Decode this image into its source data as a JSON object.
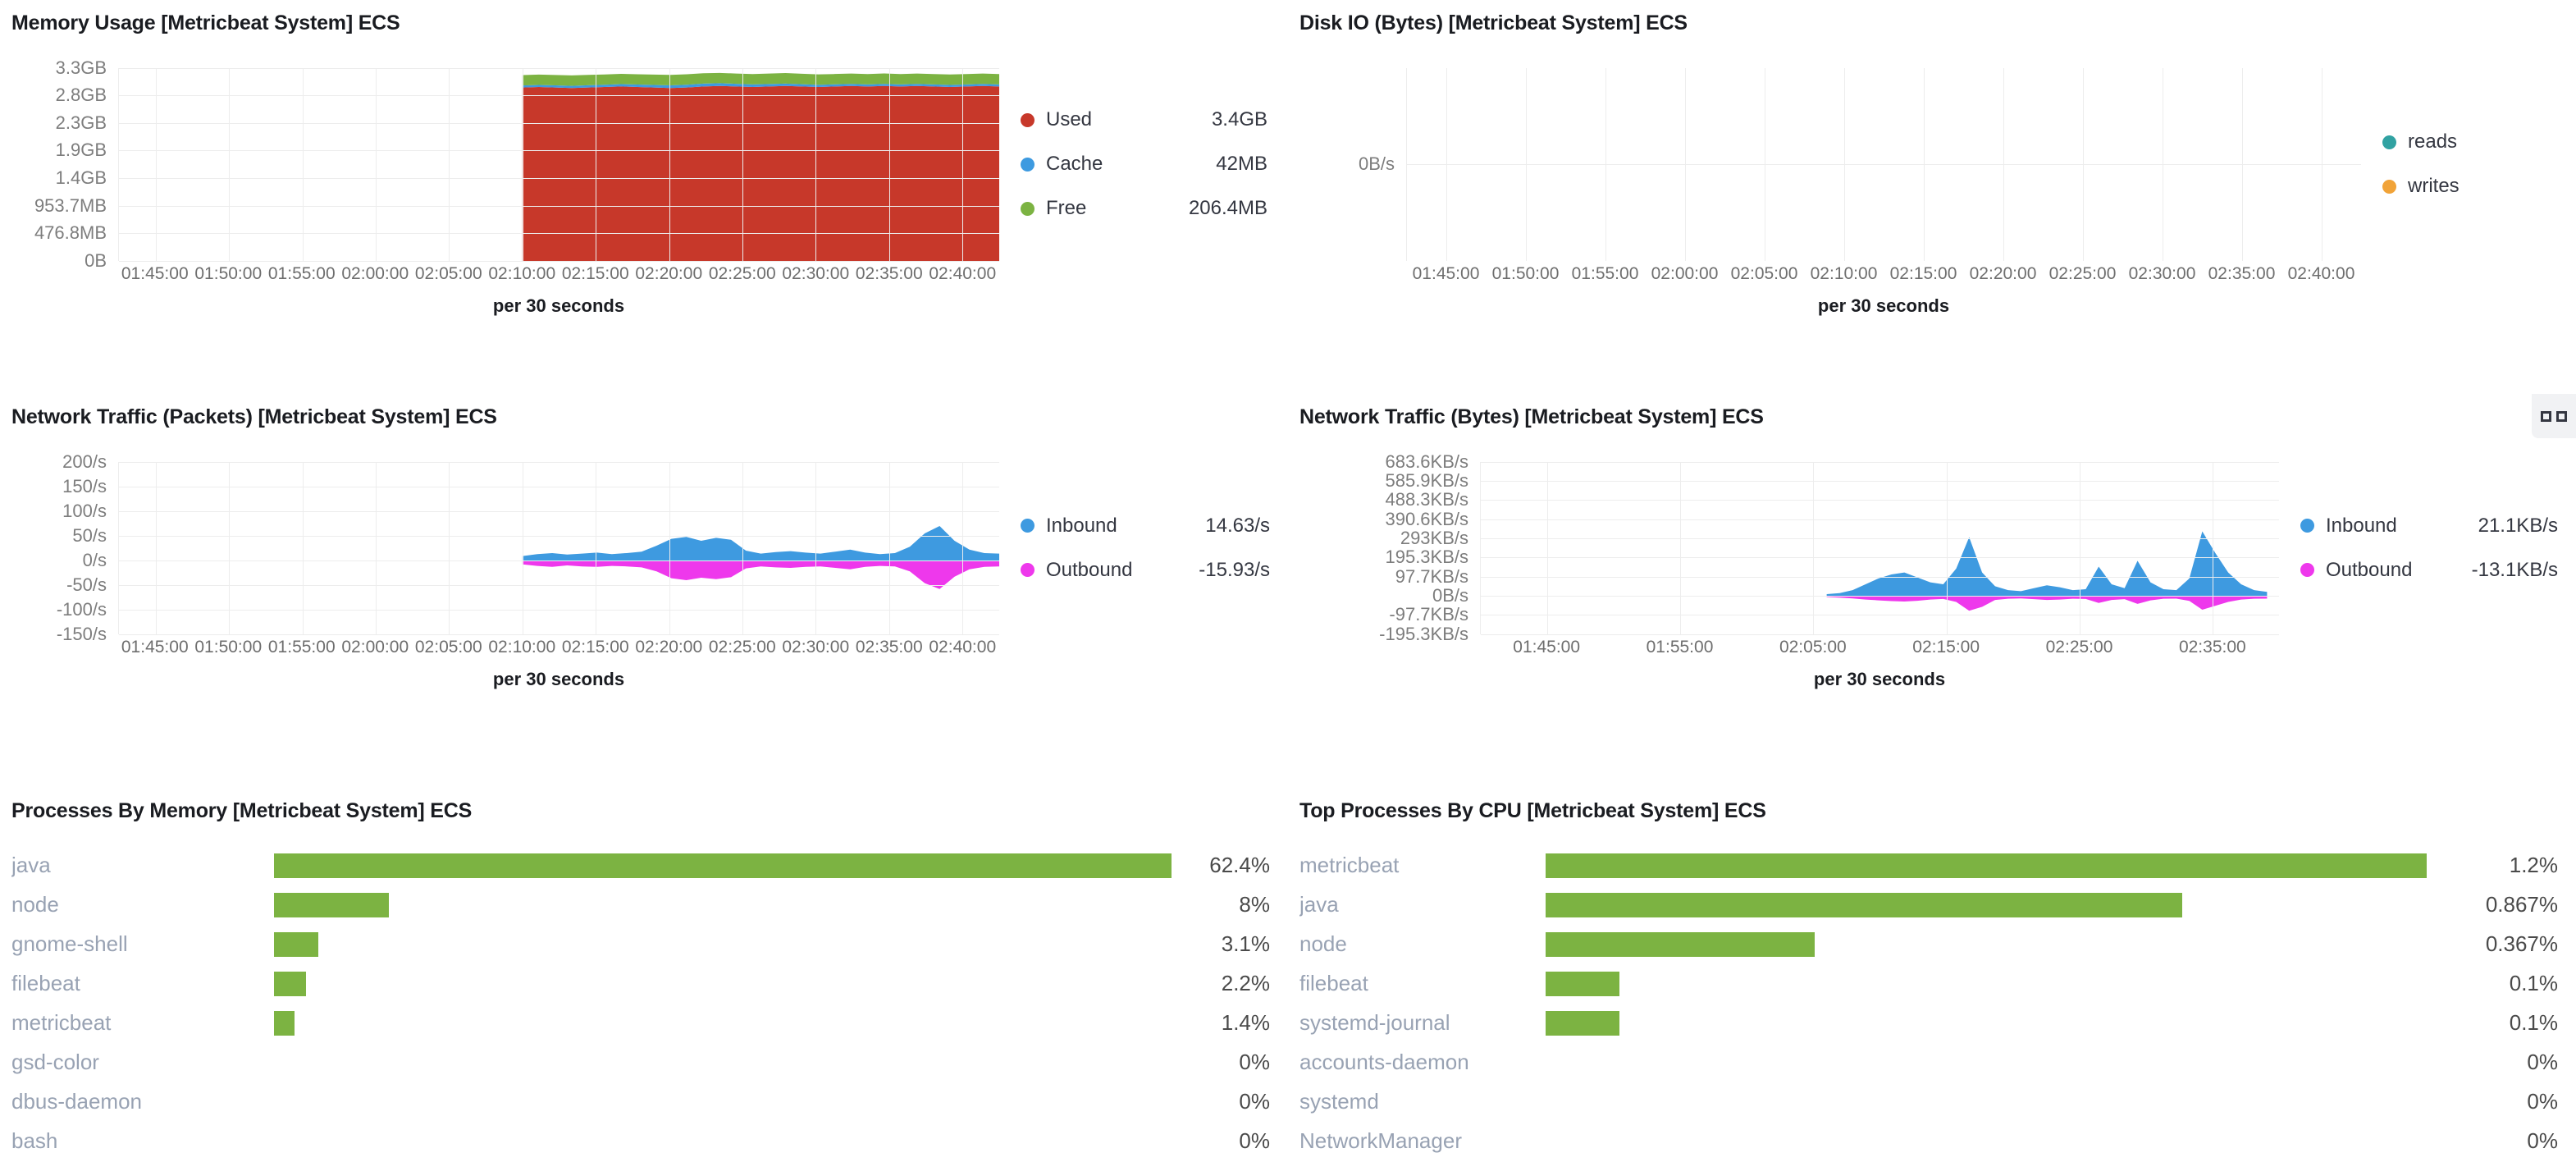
{
  "colors": {
    "used": "#c7382a",
    "cache": "#3d9ae0",
    "free": "#7cb342",
    "inbound": "#3e9ae0",
    "outbound": "#ee38ec",
    "reads": "#31a2a2",
    "writes": "#f1a338",
    "bar": "#7cb342",
    "grid": "#ededed",
    "axis_text": "#7d7d7d",
    "label_text": "#98a2b3"
  },
  "panels": {
    "memory": {
      "title": "Memory Usage [Metricbeat System] ECS",
      "x_label": "per 30 seconds",
      "legend": [
        {
          "label": "Used",
          "value": "3.4GB",
          "color_key": "used"
        },
        {
          "label": "Cache",
          "value": "42MB",
          "color_key": "cache"
        },
        {
          "label": "Free",
          "value": "206.4MB",
          "color_key": "free"
        }
      ]
    },
    "disk_io": {
      "title": "Disk IO (Bytes) [Metricbeat System] ECS",
      "x_label": "per 30 seconds",
      "legend": [
        {
          "label": "reads",
          "value": "",
          "color_key": "reads"
        },
        {
          "label": "writes",
          "value": "",
          "color_key": "writes"
        }
      ]
    },
    "net_packets": {
      "title": "Network Traffic (Packets) [Metricbeat System] ECS",
      "x_label": "per 30 seconds",
      "legend": [
        {
          "label": "Inbound",
          "value": "14.63/s",
          "color_key": "inbound"
        },
        {
          "label": "Outbound",
          "value": "-15.93/s",
          "color_key": "outbound"
        }
      ]
    },
    "net_bytes": {
      "title": "Network Traffic (Bytes) [Metricbeat System] ECS",
      "x_label": "per 30 seconds",
      "menu_icon": "panel-options-icon",
      "legend": [
        {
          "label": "Inbound",
          "value": "21.1KB/s",
          "color_key": "inbound"
        },
        {
          "label": "Outbound",
          "value": "-13.1KB/s",
          "color_key": "outbound"
        }
      ]
    },
    "proc_memory": {
      "title": "Processes By Memory [Metricbeat System] ECS"
    },
    "proc_cpu": {
      "title": "Top Processes By CPU [Metricbeat System] ECS"
    }
  },
  "chart_data": [
    {
      "id": "memory_usage",
      "type": "area",
      "title": "Memory Usage [Metricbeat System] ECS",
      "xlabel": "per 30 seconds",
      "ylabel": "",
      "grid": true,
      "legend_position": "right",
      "yticks": [
        "3.3GB",
        "2.8GB",
        "2.3GB",
        "1.9GB",
        "1.4GB",
        "953.7MB",
        "476.8MB",
        "0B"
      ],
      "ytick_values": [
        3543348019,
        3006477107,
        2469606195,
        2040109465,
        1503238553,
        1000000000,
        500000000,
        0
      ],
      "ylim": [
        0,
        3758096384
      ],
      "xticks": [
        "01:45:00",
        "01:50:00",
        "01:55:00",
        "02:00:00",
        "02:05:00",
        "02:10:00",
        "02:15:00",
        "02:20:00",
        "02:25:00",
        "02:30:00",
        "02:35:00",
        "02:40:00"
      ],
      "data_start_tick": "02:10:00",
      "stacked": true,
      "series": [
        {
          "name": "Used",
          "color": "#c7382a",
          "units": "GB",
          "values": [
            3.38,
            3.39,
            3.38,
            3.37,
            3.38,
            3.39,
            3.4,
            3.39,
            3.38,
            3.37,
            3.38,
            3.4,
            3.41,
            3.4,
            3.39,
            3.4,
            3.41,
            3.4,
            3.39,
            3.4,
            3.41,
            3.4,
            3.41,
            3.4,
            3.41,
            3.4,
            3.39,
            3.4,
            3.41,
            3.4
          ]
        },
        {
          "name": "Cache",
          "color": "#3d9ae0",
          "units": "MB",
          "values": [
            42,
            42,
            43,
            44,
            45,
            46,
            48,
            50,
            52,
            54,
            56,
            58,
            56,
            54,
            52,
            50,
            48,
            46,
            44,
            43,
            42,
            42,
            42,
            42,
            42,
            42,
            42,
            42,
            42,
            42
          ]
        },
        {
          "name": "Free",
          "color": "#7cb342",
          "units": "MB",
          "values": [
            206.4,
            205,
            207,
            208,
            206,
            204,
            203,
            205,
            207,
            209,
            208,
            206,
            205,
            204,
            206,
            208,
            210,
            209,
            207,
            206,
            205,
            206,
            207,
            206,
            205,
            206,
            207,
            206,
            205,
            206.4
          ]
        }
      ],
      "current": {
        "Used": "3.4GB",
        "Cache": "42MB",
        "Free": "206.4MB"
      }
    },
    {
      "id": "disk_io_bytes",
      "type": "line",
      "title": "Disk IO (Bytes) [Metricbeat System] ECS",
      "xlabel": "per 30 seconds",
      "grid": true,
      "legend_position": "right",
      "yticks": [
        "0B/s"
      ],
      "ylim": [
        0,
        0
      ],
      "xticks": [
        "01:45:00",
        "01:50:00",
        "01:55:00",
        "02:00:00",
        "02:05:00",
        "02:10:00",
        "02:15:00",
        "02:20:00",
        "02:25:00",
        "02:30:00",
        "02:35:00",
        "02:40:00"
      ],
      "series": [
        {
          "name": "reads",
          "color": "#31a2a2",
          "values": []
        },
        {
          "name": "writes",
          "color": "#f1a338",
          "values": []
        }
      ],
      "note": "no data plotted"
    },
    {
      "id": "network_packets",
      "type": "area",
      "title": "Network Traffic (Packets) [Metricbeat System] ECS",
      "xlabel": "per 30 seconds",
      "grid": true,
      "legend_position": "right",
      "yticks": [
        "200/s",
        "150/s",
        "100/s",
        "50/s",
        "0/s",
        "-50/s",
        "-100/s",
        "-150/s"
      ],
      "ytick_values": [
        200,
        150,
        100,
        50,
        0,
        -50,
        -100,
        -150
      ],
      "ylim": [
        -150,
        200
      ],
      "xticks": [
        "01:45:00",
        "01:50:00",
        "01:55:00",
        "02:00:00",
        "02:05:00",
        "02:10:00",
        "02:15:00",
        "02:20:00",
        "02:25:00",
        "02:30:00",
        "02:35:00",
        "02:40:00"
      ],
      "data_start_tick": "02:10:00",
      "series": [
        {
          "name": "Inbound",
          "color": "#3e9ae0",
          "values": [
            9,
            13,
            15,
            12,
            14,
            16,
            13,
            15,
            18,
            30,
            44,
            48,
            40,
            46,
            42,
            20,
            14,
            17,
            19,
            16,
            14,
            18,
            22,
            16,
            13,
            15,
            28,
            55,
            70,
            40,
            22,
            15,
            14
          ]
        },
        {
          "name": "Outbound",
          "color": "#ee38ec",
          "values": [
            -8,
            -11,
            -13,
            -10,
            -12,
            -13,
            -11,
            -12,
            -14,
            -22,
            -36,
            -40,
            -35,
            -38,
            -34,
            -16,
            -12,
            -14,
            -15,
            -13,
            -12,
            -15,
            -18,
            -13,
            -11,
            -12,
            -22,
            -46,
            -58,
            -33,
            -18,
            -13,
            -12
          ]
        }
      ],
      "current": {
        "Inbound": "14.63/s",
        "Outbound": "-15.93/s"
      }
    },
    {
      "id": "network_bytes",
      "type": "area",
      "title": "Network Traffic (Bytes) [Metricbeat System] ECS",
      "xlabel": "per 30 seconds",
      "grid": true,
      "legend_position": "right",
      "yticks": [
        "683.6KB/s",
        "585.9KB/s",
        "488.3KB/s",
        "390.6KB/s",
        "293KB/s",
        "195.3KB/s",
        "97.7KB/s",
        "0B/s",
        "-97.7KB/s",
        "-195.3KB/s"
      ],
      "ytick_values": [
        683.6,
        585.9,
        488.3,
        390.6,
        293,
        195.3,
        97.7,
        0,
        -97.7,
        -195.3
      ],
      "ylim": [
        -195.3,
        683.6
      ],
      "xticks": [
        "01:45:00",
        "01:55:00",
        "02:05:00",
        "02:15:00",
        "02:25:00",
        "02:35:00"
      ],
      "data_start_tick": "02:10:00",
      "series": [
        {
          "name": "Inbound",
          "color": "#3e9ae0",
          "units": "KB/s",
          "values": [
            10,
            15,
            30,
            60,
            90,
            110,
            120,
            95,
            70,
            60,
            140,
            300,
            120,
            50,
            30,
            25,
            40,
            55,
            45,
            30,
            35,
            150,
            60,
            40,
            180,
            70,
            35,
            30,
            90,
            330,
            220,
            120,
            60,
            30,
            21.1
          ]
        },
        {
          "name": "Outbound",
          "color": "#ee38ec",
          "units": "KB/s",
          "values": [
            -5,
            -8,
            -12,
            -18,
            -22,
            -26,
            -28,
            -24,
            -18,
            -15,
            -30,
            -75,
            -55,
            -20,
            -14,
            -12,
            -16,
            -20,
            -18,
            -14,
            -15,
            -35,
            -20,
            -16,
            -40,
            -22,
            -14,
            -13,
            -25,
            -70,
            -50,
            -30,
            -18,
            -14,
            -13.1
          ]
        }
      ],
      "current": {
        "Inbound": "21.1KB/s",
        "Outbound": "-13.1KB/s"
      }
    },
    {
      "id": "processes_by_memory",
      "type": "bar",
      "orientation": "horizontal",
      "title": "Processes By Memory [Metricbeat System] ECS",
      "xlabel": "",
      "ylabel": "",
      "categories": [
        "java",
        "node",
        "gnome-shell",
        "filebeat",
        "metricbeat",
        "gsd-color",
        "dbus-daemon",
        "bash"
      ],
      "values": [
        62.4,
        8,
        3.1,
        2.2,
        1.4,
        0,
        0,
        0
      ],
      "value_labels": [
        "62.4%",
        "8%",
        "3.1%",
        "2.2%",
        "1.4%",
        "0%",
        "0%",
        "0%"
      ],
      "max": 62.4,
      "bar_color": "#7cb342"
    },
    {
      "id": "top_processes_by_cpu",
      "type": "bar",
      "orientation": "horizontal",
      "title": "Top Processes By CPU [Metricbeat System] ECS",
      "xlabel": "",
      "ylabel": "",
      "categories": [
        "metricbeat",
        "java",
        "node",
        "filebeat",
        "systemd-journal",
        "accounts-daemon",
        "systemd",
        "NetworkManager"
      ],
      "values": [
        1.2,
        0.867,
        0.367,
        0.1,
        0.1,
        0,
        0,
        0
      ],
      "value_labels": [
        "1.2%",
        "0.867%",
        "0.367%",
        "0.1%",
        "0.1%",
        "0%",
        "0%",
        "0%"
      ],
      "max": 1.2,
      "bar_color": "#7cb342"
    }
  ]
}
